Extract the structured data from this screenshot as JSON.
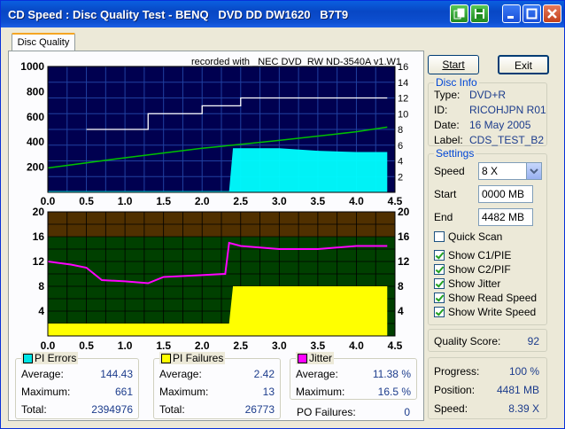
{
  "window": {
    "title": "CD Speed : Disc Quality Test - BENQ   DVD DD DW1620   B7T9"
  },
  "tab": {
    "label": "Disc Quality"
  },
  "chart_header": "recorded with _NEC   DVD_RW ND-3540A  v1.W1",
  "buttons": {
    "start": "Start",
    "exit": "Exit"
  },
  "disc_info": {
    "title": "Disc Info",
    "rows": [
      {
        "label": "Type:",
        "value": "DVD+R"
      },
      {
        "label": "ID:",
        "value": "RICOHJPN R01"
      },
      {
        "label": "Date:",
        "value": "16 May 2005"
      },
      {
        "label": "Label:",
        "value": "CDS_TEST_B2"
      }
    ]
  },
  "settings": {
    "title": "Settings",
    "speed_label": "Speed",
    "speed_value": "8 X",
    "start_label": "Start",
    "start_value": "0000 MB",
    "end_label": "End",
    "end_value": "4482 MB",
    "quick_scan": "Quick Scan",
    "checks": [
      {
        "label": "Show C1/PIE",
        "checked": true
      },
      {
        "label": "Show C2/PIF",
        "checked": true
      },
      {
        "label": "Show Jitter",
        "checked": true
      },
      {
        "label": "Show Read Speed",
        "checked": true
      },
      {
        "label": "Show Write Speed",
        "checked": true
      }
    ]
  },
  "quality": {
    "label": "Quality Score:",
    "value": "92"
  },
  "progress": {
    "rows": [
      {
        "label": "Progress:",
        "value": "100 %"
      },
      {
        "label": "Position:",
        "value": "4481 MB"
      },
      {
        "label": "Speed:",
        "value": "8.39 X"
      }
    ]
  },
  "pi_errors": {
    "title": "PI Errors",
    "color": "#00e5e5",
    "rows": [
      {
        "label": "Average:",
        "value": "144.43"
      },
      {
        "label": "Maximum:",
        "value": "661"
      },
      {
        "label": "Total:",
        "value": "2394976"
      }
    ]
  },
  "pi_failures": {
    "title": "PI Failures",
    "color": "#ffff00",
    "rows": [
      {
        "label": "Average:",
        "value": "2.42"
      },
      {
        "label": "Maximum:",
        "value": "13"
      },
      {
        "label": "Total:",
        "value": "26773"
      }
    ]
  },
  "jitter": {
    "title": "Jitter",
    "color": "#ff00ff",
    "rows": [
      {
        "label": "Average:",
        "value": "11.38 %"
      },
      {
        "label": "Maximum:",
        "value": "16.5 %"
      }
    ]
  },
  "po_failures": {
    "label": "PO Failures:",
    "value": "0"
  },
  "chart_data": [
    {
      "type": "area",
      "x_ticks": [
        "0.0",
        "0.5",
        "1.0",
        "1.5",
        "2.0",
        "2.5",
        "3.0",
        "3.5",
        "4.0",
        "4.5"
      ],
      "y_left_ticks": [
        "1000",
        "800",
        "600",
        "400",
        "200"
      ],
      "y_right_ticks": [
        "16",
        "14",
        "12",
        "10",
        "8",
        "6",
        "4",
        "2"
      ],
      "xlim": [
        0,
        4.5
      ],
      "ylim_left": [
        0,
        1000
      ],
      "ylim_right": [
        0,
        16
      ],
      "series": [
        {
          "name": "PI Errors",
          "color": "#00ffff",
          "x": [
            0.0,
            0.5,
            1.0,
            1.5,
            2.0,
            2.35,
            2.4,
            3.0,
            3.5,
            4.0,
            4.4
          ],
          "values": [
            10,
            10,
            10,
            10,
            10,
            10,
            350,
            350,
            330,
            320,
            320
          ]
        },
        {
          "name": "Read Speed",
          "color": "#00c000",
          "x": [
            0.0,
            1.0,
            2.0,
            3.0,
            4.0,
            4.4
          ],
          "values": [
            3.1,
            4.4,
            5.6,
            6.6,
            7.7,
            8.3
          ]
        },
        {
          "name": "Write Speed",
          "color": "#ffffff",
          "x": [
            0.5,
            0.6,
            1.0,
            1.3,
            1.5,
            2.0,
            2.35,
            2.5,
            3.0,
            3.5,
            4.0,
            4.4
          ],
          "values": [
            8,
            8,
            8,
            10,
            10,
            11,
            11,
            12,
            12,
            12,
            12,
            12
          ]
        }
      ]
    },
    {
      "type": "area",
      "x_ticks": [
        "0.0",
        "0.5",
        "1.0",
        "1.5",
        "2.0",
        "2.5",
        "3.0",
        "3.5",
        "4.0",
        "4.5"
      ],
      "y_left_ticks": [
        "20",
        "16",
        "12",
        "8",
        "4"
      ],
      "y_right_ticks": [
        "20",
        "16",
        "12",
        "8",
        "4"
      ],
      "xlim": [
        0,
        4.5
      ],
      "ylim": [
        0,
        20
      ],
      "series": [
        {
          "name": "PI Failures",
          "color": "#ffff00",
          "x": [
            0.0,
            0.5,
            1.0,
            1.5,
            2.0,
            2.35,
            2.4,
            3.0,
            3.5,
            4.0,
            4.4
          ],
          "values": [
            2,
            2,
            2,
            2,
            2,
            2,
            8,
            8,
            8,
            8,
            8
          ]
        },
        {
          "name": "Jitter",
          "color": "#ff00ff",
          "x": [
            0.0,
            0.3,
            0.5,
            0.7,
            1.0,
            1.3,
            1.5,
            2.0,
            2.3,
            2.35,
            2.5,
            3.0,
            3.5,
            4.0,
            4.4
          ],
          "values": [
            12,
            11.5,
            11,
            9,
            8.8,
            8.5,
            9.5,
            9.8,
            10,
            15,
            14.5,
            14,
            14,
            14.5,
            14.5
          ]
        }
      ]
    }
  ]
}
